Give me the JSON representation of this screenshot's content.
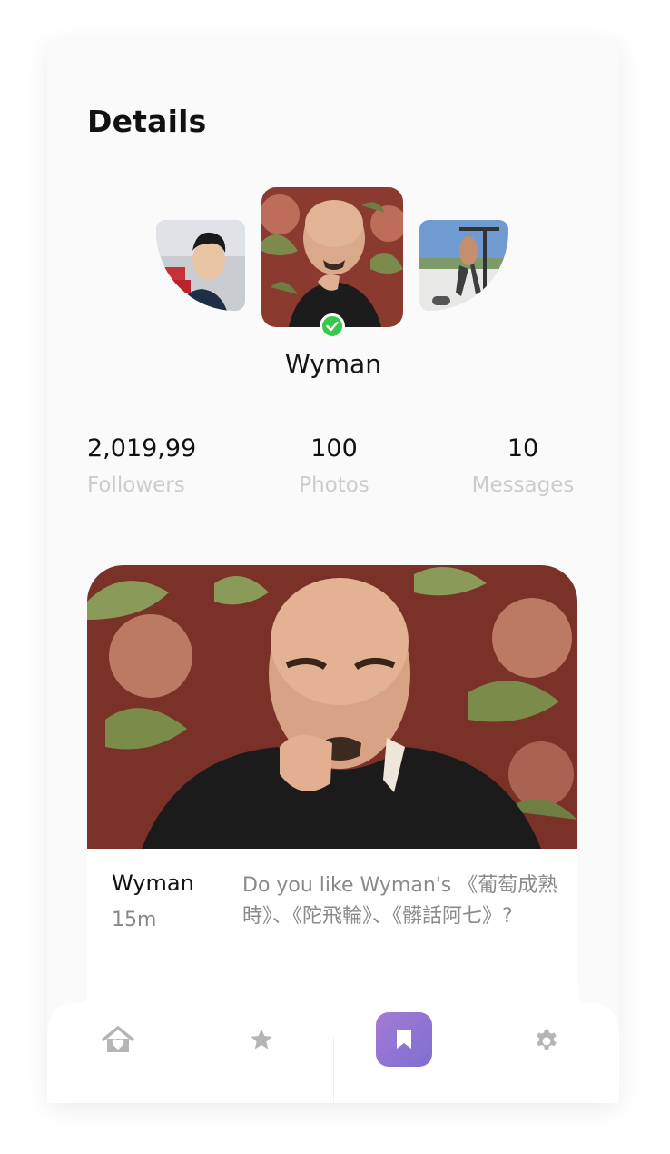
{
  "header": {
    "title": "Details"
  },
  "profile": {
    "name": "Wyman",
    "verified": true,
    "avatars": [
      {
        "name": "left-avatar",
        "icon": "person-photo"
      },
      {
        "name": "main-avatar",
        "icon": "person-photo"
      },
      {
        "name": "right-avatar",
        "icon": "person-photo"
      }
    ]
  },
  "stats": {
    "followers": {
      "value": "2,019,99",
      "label": "Followers"
    },
    "photos": {
      "value": "100",
      "label": "Photos"
    },
    "messages": {
      "value": "10",
      "label": "Messages"
    }
  },
  "post": {
    "author": "Wyman",
    "time": "15m",
    "text": "Do you like Wyman's 《葡萄成熟時》、《陀飛輪》、《髒話阿七》?"
  },
  "nav": {
    "items": [
      {
        "name": "home",
        "icon": "home-heart-icon",
        "active": false
      },
      {
        "name": "favorites",
        "icon": "star-icon",
        "active": false
      },
      {
        "name": "bookmarks",
        "icon": "bookmark-icon",
        "active": true
      },
      {
        "name": "settings",
        "icon": "gear-icon",
        "active": false
      }
    ],
    "active_gradient": [
      "#a57ad6",
      "#7d6fd0"
    ],
    "inactive_color": "#b5b5b5"
  },
  "colors": {
    "verified": "#39c94a",
    "label": "#cccccc"
  }
}
